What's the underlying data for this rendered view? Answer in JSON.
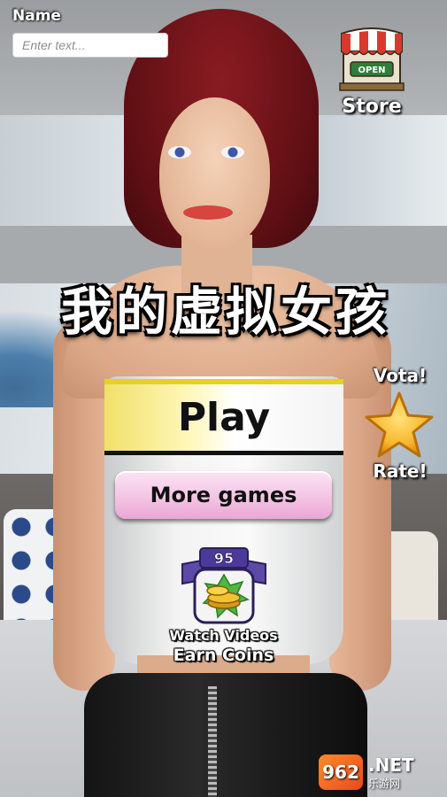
{
  "header": {
    "name_label": "Name",
    "name_placeholder": "Enter text...",
    "store_label": "Store",
    "store_sign": "OPEN"
  },
  "title": "我的虚拟女孩",
  "rating": {
    "top_label": "Vota!",
    "bottom_label": "Rate!",
    "star_icon": "star-icon",
    "star_color": "#f7b62a"
  },
  "menu": {
    "play_label": "Play",
    "more_games_label": "More games"
  },
  "rewards": {
    "coin_count": "95",
    "line1": "Watch Videos",
    "line2": "Earn Coins",
    "icon": "coins-badge-icon"
  },
  "watermark": {
    "number": "962",
    "net": ".NET",
    "site": "乐游网"
  },
  "colors": {
    "play_accent": "#e6d21a",
    "more_games_bg": "#f5c8e6",
    "hair": "#7a1a20",
    "store_awning_red": "#d63a2f",
    "store_sign_green": "#2f7d3a"
  }
}
